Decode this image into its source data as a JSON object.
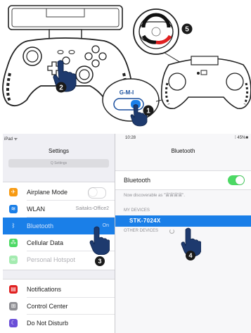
{
  "steps": {
    "step1": "1",
    "step2": "2",
    "step3": "3",
    "step4": "4",
    "step5": "5"
  },
  "switch_label": "G-M-I",
  "colors": {
    "accent_blue": "#1a7fe8",
    "toggle_on": "#4cd964",
    "led_red": "#e02020"
  },
  "ipad": {
    "status": {
      "left": "iPad ᯤ",
      "time": "10:28",
      "right": "⁞ 45%■"
    },
    "left_title": "Settings",
    "search_placeholder": "Q Settings",
    "right_title": "Bluetooth",
    "settings": [
      {
        "label": "Airplane Mode",
        "icon": "airplane-icon",
        "icon_color": "#f79a12"
      },
      {
        "label": "WLAN",
        "value": "Saitaks-Office2",
        "icon": "wifi-icon",
        "icon_color": "#1a7fe8"
      },
      {
        "label": "Bluetooth",
        "value": "On",
        "icon": "bluetooth-icon",
        "icon_color": "#1a7fe8"
      },
      {
        "label": "Cellular Data",
        "icon": "cellular-icon",
        "icon_color": "#4cd964"
      },
      {
        "label": "Personal Hotspot",
        "icon": "hotspot-icon",
        "icon_color": "#4cd964"
      },
      {
        "label": "Notifications",
        "icon": "notifications-icon",
        "icon_color": "#e02020"
      },
      {
        "label": "Control Center",
        "icon": "control-center-icon",
        "icon_color": "#8e8e93"
      },
      {
        "label": "Do Not Disturb",
        "icon": "moon-icon",
        "icon_color": "#6b4fd8"
      }
    ],
    "bluetooth_label": "Bluetooth",
    "discoverable_text": "Now discoverable as \"宙宙宙宙\".",
    "my_devices_header": "MY DEVICES",
    "device_name": "STK-7024X",
    "other_devices_header": "OTHER DEVICES"
  }
}
